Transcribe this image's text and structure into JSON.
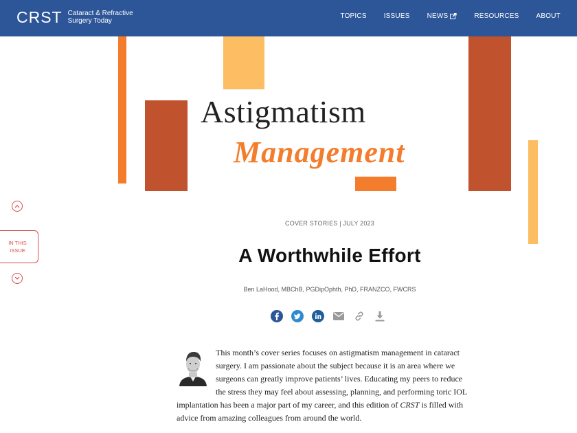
{
  "header": {
    "logo_mark": "CRST",
    "logo_sub_line1": "Cataract & Refractive",
    "logo_sub_line2": "Surgery Today",
    "nav": [
      {
        "label": "TOPICS"
      },
      {
        "label": "ISSUES"
      },
      {
        "label": "NEWS"
      },
      {
        "label": "RESOURCES"
      },
      {
        "label": "ABOUT"
      }
    ]
  },
  "hero": {
    "title_line1": "Astigmatism",
    "title_line2": "Management",
    "colors": {
      "orange": "#f47d2d",
      "rust": "#c0522e",
      "light_orange": "#fdbd63"
    }
  },
  "side": {
    "in_this_issue_line1": "IN THIS",
    "in_this_issue_line2": "ISSUE"
  },
  "article": {
    "kicker": "COVER STORIES | JULY 2023",
    "headline": "A Worthwhile Effort",
    "byline": "Ben LaHood, MBChB, PGDipOphth, PhD, FRANZCO, FWCRS",
    "share_icons": [
      "facebook-icon",
      "twitter-icon",
      "linkedin-icon",
      "email-icon",
      "link-icon",
      "download-icon"
    ],
    "intro_lines": [
      "This month’s cover series focuses on astigmatism management in cataract",
      "surgery. I am passionate about the subject because it is an area where we",
      "surgeons can greatly improve patients’ lives. Educating my peers to reduce",
      "the stress they may feel about assessing, planning, and performing toric IOL",
      "implantation has been a major part of my career, and this edition of ",
      "advice from amazing colleagues from around the world."
    ],
    "intro_italic": "CRST",
    "intro_line5_end": " is filled with"
  }
}
